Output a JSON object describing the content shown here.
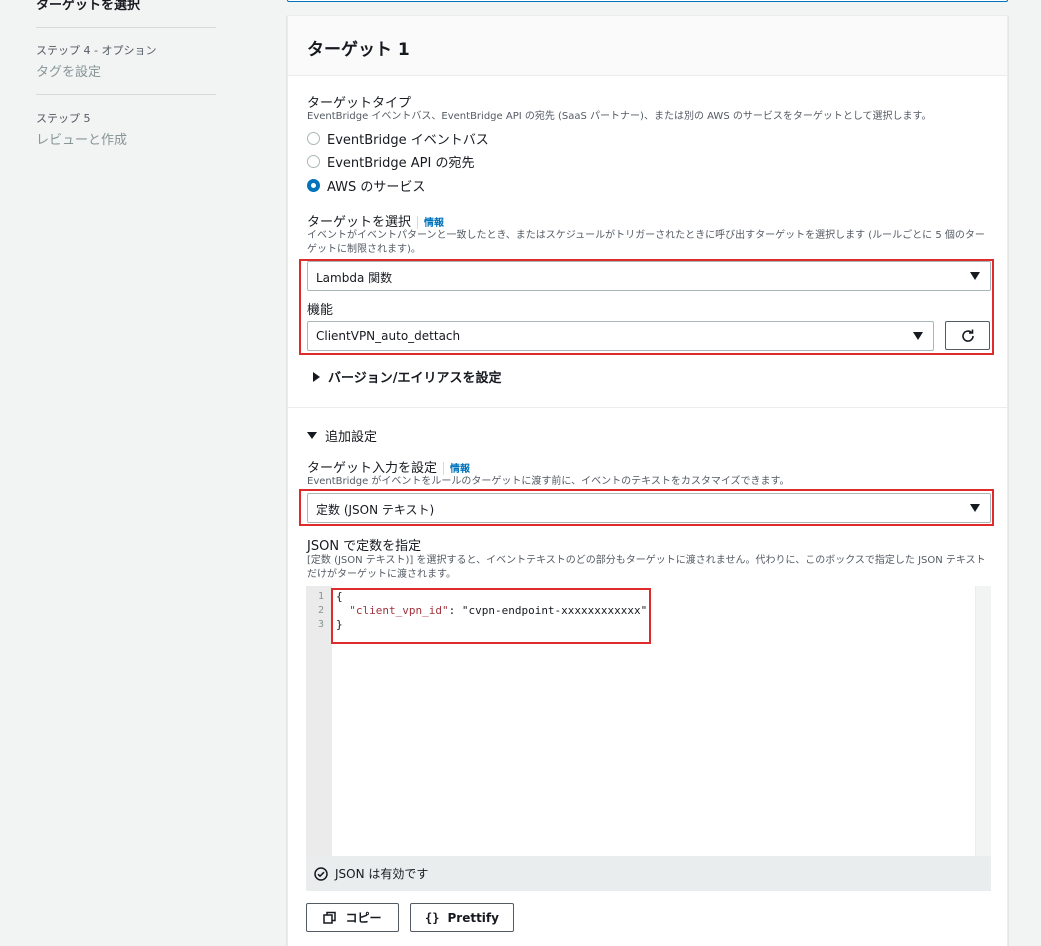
{
  "steps": {
    "current": "ターゲットを選択",
    "step4_label": "ステップ 4 - オプション",
    "step4_sub": "タグを設定",
    "step5_label": "ステップ 5",
    "step5_sub": "レビューと作成"
  },
  "panel": {
    "title": "ターゲット 1"
  },
  "target_type": {
    "label": "ターゲットタイプ",
    "description": "EventBridge イベントバス、EventBridge API の宛先 (SaaS パートナー)、または別の AWS のサービスをターゲットとして選択します。",
    "options": [
      {
        "label": "EventBridge イベントバス",
        "selected": false
      },
      {
        "label": "EventBridge API の宛先",
        "selected": false
      },
      {
        "label": "AWS のサービス",
        "selected": true
      }
    ]
  },
  "select_target": {
    "label": "ターゲットを選択",
    "info": "情報",
    "description": "イベントがイベントパターンと一致したとき、またはスケジュールがトリガーされたときに呼び出すターゲットを選択します (ルールごとに 5 個のターゲットに制限されます)。",
    "value": "Lambda 関数"
  },
  "function": {
    "label": "機能",
    "value": "ClientVPN_auto_dettach"
  },
  "version_alias": {
    "label": "バージョン/エイリアスを設定"
  },
  "additional": {
    "label": "追加設定"
  },
  "target_input": {
    "label": "ターゲット入力を設定",
    "info": "情報",
    "description": "EventBridge がイベントをルールのターゲットに渡す前に、イベントのテキストをカスタマイズできます。",
    "value": "定数 (JSON テキスト)"
  },
  "json_constant": {
    "label": "JSON で定数を指定",
    "description": "[定数 (JSON テキスト)] を選択すると、イベントテキストのどの部分もターゲットに渡されません。代わりに、このボックスで指定した JSON テキストだけがターゲットに渡されます。",
    "line_numbers": [
      "1",
      "2",
      "3"
    ],
    "code_open": "{",
    "code_key": "\"client_vpn_id\"",
    "code_colon": ": ",
    "code_value": "\"cvpn-endpoint-xxxxxxxxxxxx\"",
    "code_close": "}",
    "status": "JSON は有効です"
  },
  "buttons": {
    "copy": "コピー",
    "prettify": "Prettify"
  },
  "colors": {
    "accent": "#0073bb",
    "highlight": "#e02b2b"
  }
}
